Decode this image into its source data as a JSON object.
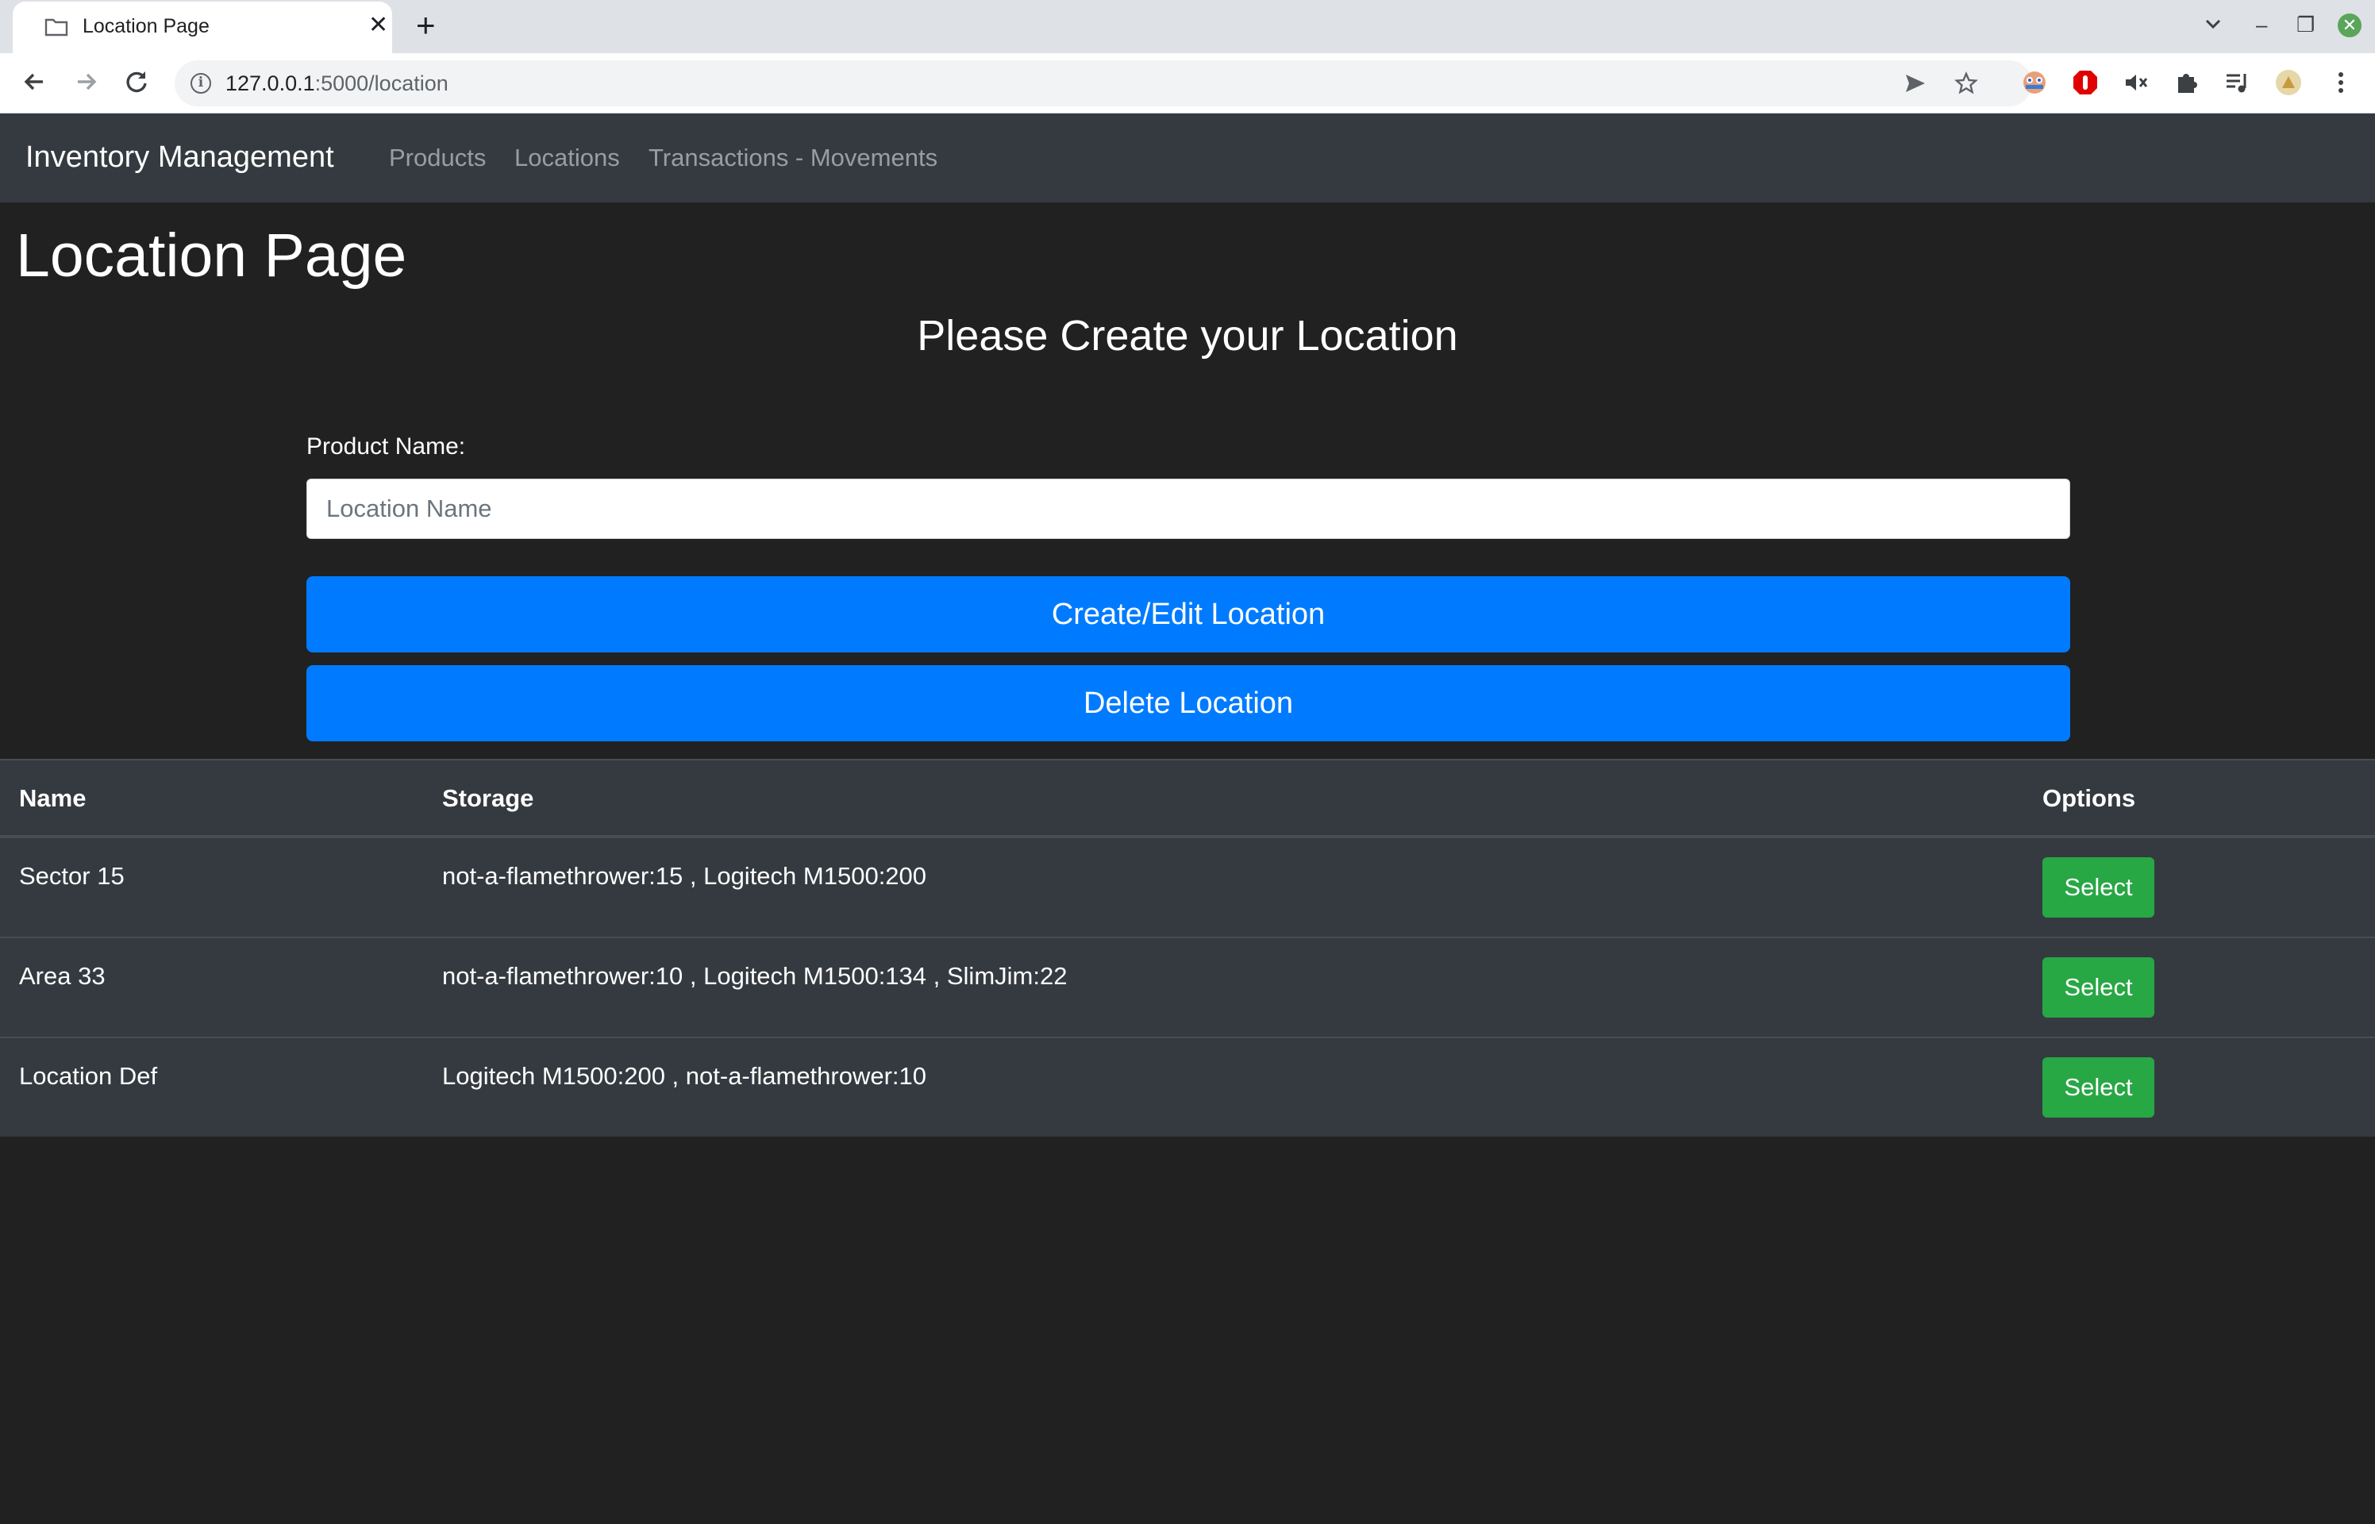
{
  "browser": {
    "tab_title": "Location Page",
    "tab_close": "✕",
    "new_tab": "+",
    "url_host": "127.0.0.1",
    "url_path": ":5000/location",
    "minimize": "–",
    "restore": "❐",
    "close": "✕"
  },
  "navbar": {
    "brand": "Inventory Management",
    "links": [
      "Products",
      "Locations",
      "Transactions - Movements"
    ]
  },
  "page": {
    "title": "Location Page",
    "subtitle": "Please Create your Location"
  },
  "form": {
    "label": "Product Name:",
    "input_placeholder": "Location Name",
    "input_value": "",
    "create_button": "Create/Edit Location",
    "delete_button": "Delete Location"
  },
  "table": {
    "headers": [
      "Name",
      "Storage",
      "Options"
    ],
    "rows": [
      {
        "name": "Sector 15",
        "storage": "not-a-flamethrower:15 , Logitech M1500:200",
        "action": "Select"
      },
      {
        "name": "Area 33",
        "storage": "not-a-flamethrower:10 , Logitech M1500:134 , SlimJim:22",
        "action": "Select"
      },
      {
        "name": "Location Def",
        "storage": "Logitech M1500:200 , not-a-flamethrower:10",
        "action": "Select"
      }
    ]
  },
  "colors": {
    "primary": "#007bff",
    "success": "#28a745",
    "navbar": "#343a40",
    "background": "#212121"
  }
}
